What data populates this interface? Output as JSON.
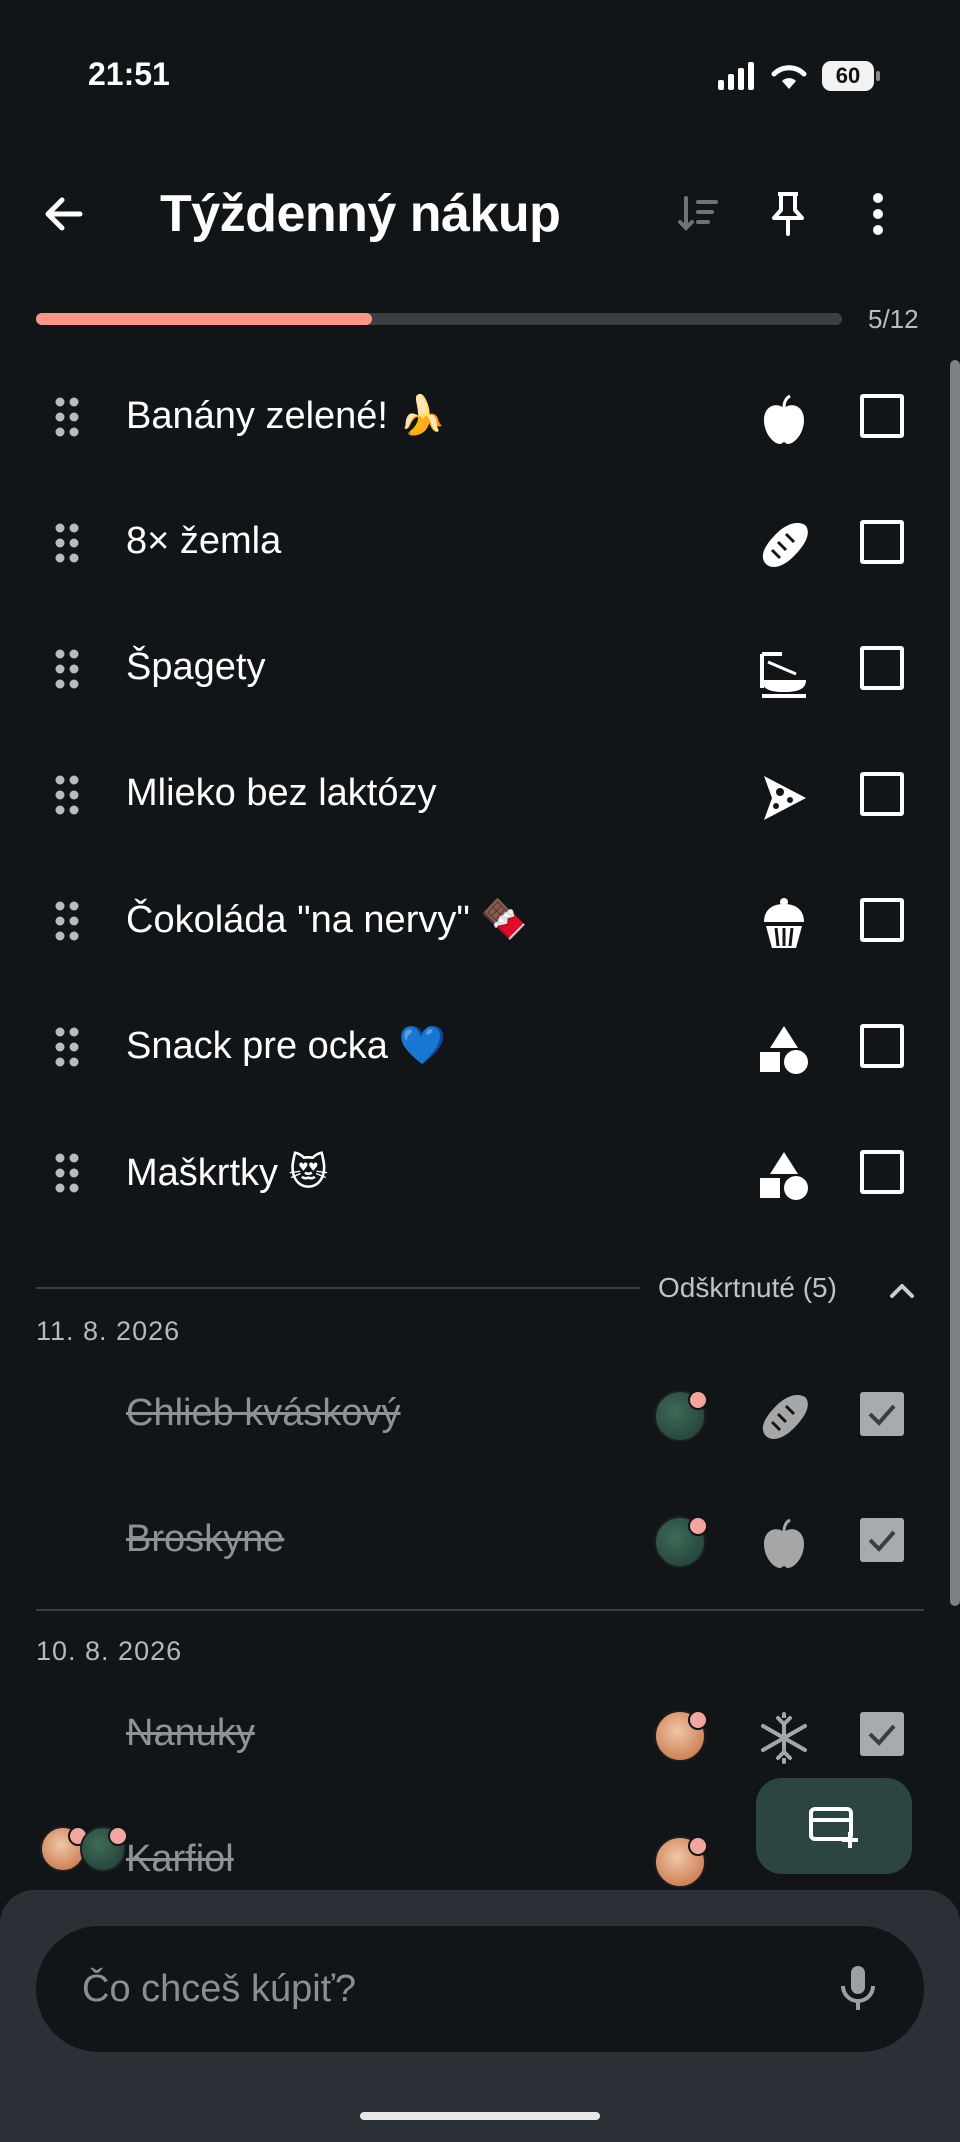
{
  "status_bar": {
    "time": "21:51",
    "battery": "60"
  },
  "app_bar": {
    "title": "Týždenný nákup"
  },
  "progress": {
    "label": "5/12",
    "done": 5,
    "total": 12
  },
  "items": [
    {
      "label": "Banány zelené! 🍌",
      "category_icon": "apple-icon"
    },
    {
      "label": "8× žemla",
      "category_icon": "bread-icon"
    },
    {
      "label": "Špagety",
      "category_icon": "pasta-icon"
    },
    {
      "label": "Mlieko bez laktózy",
      "category_icon": "cheese-icon"
    },
    {
      "label": "Čokoláda \"na nervy\" 🍫",
      "category_icon": "cupcake-icon"
    },
    {
      "label": "Snack pre ocka 💙",
      "category_icon": "shapes-icon"
    },
    {
      "label": "Maškrtky 😻",
      "category_icon": "shapes-icon"
    }
  ],
  "checked_section": {
    "header": "Odškrtnuté (5)",
    "groups": [
      {
        "date": "11. 8. 2026",
        "items": [
          {
            "label": "Chlieb kváskový",
            "category_icon": "bread-icon"
          },
          {
            "label": "Broskyne",
            "category_icon": "apple-icon"
          }
        ]
      },
      {
        "date": "10. 8. 2026",
        "items": [
          {
            "label": "Nanuky",
            "category_icon": "snowflake-icon"
          },
          {
            "label": "Karfiol",
            "category_icon": "apple-icon"
          }
        ]
      }
    ]
  },
  "input": {
    "placeholder": "Čo chceš kúpiť?"
  },
  "colors": {
    "accent": "#f7978a",
    "fab": "#2d4542",
    "background": "#121518"
  }
}
